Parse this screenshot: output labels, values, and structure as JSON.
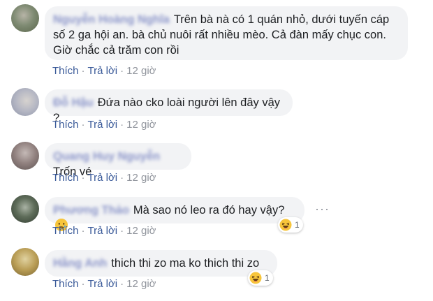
{
  "comments": [
    {
      "author": "Nguyễn Hoàng Nghĩa",
      "text": "Trên bà nà có 1 quán nhỏ, dưới tuyến cáp\nsố 2 ga hội an. bà chủ nuôi rất nhiều mèo. Cả đàn mấy chục con.\nGiờ chắc cả trăm con rồi",
      "like": "Thích",
      "reply": "Trả lời",
      "time": "12 giờ"
    },
    {
      "author": "Đỗ Hậu",
      "text": "Đứa nào cko loài người lên đây vậy ?",
      "like": "Thích",
      "reply": "Trả lời",
      "time": "12 giờ"
    },
    {
      "author": "Quang Huy Nguyễn",
      "text": "Trốn vé",
      "like": "Thích",
      "reply": "Trả lời",
      "time": "12 giờ"
    },
    {
      "author": "Phương Thảo",
      "text": "Mà sao nó leo ra đó hay vậy?",
      "inline_emoji": "sad-face",
      "like": "Thích",
      "reply": "Trả lời",
      "time": "12 giờ",
      "reaction": {
        "icon": "haha-icon",
        "count": "1"
      },
      "more": "···"
    },
    {
      "author": "Hằng Anh",
      "text": "thich thi zo ma ko thich thi zo",
      "like": "Thích",
      "reply": "Trả lời",
      "time": "12 giờ",
      "reaction": {
        "icon": "haha-icon",
        "count": "1"
      }
    }
  ],
  "colors": {
    "bubble": "#f2f3f5",
    "link": "#385898",
    "meta": "#90949c",
    "text": "#1c1e21"
  }
}
